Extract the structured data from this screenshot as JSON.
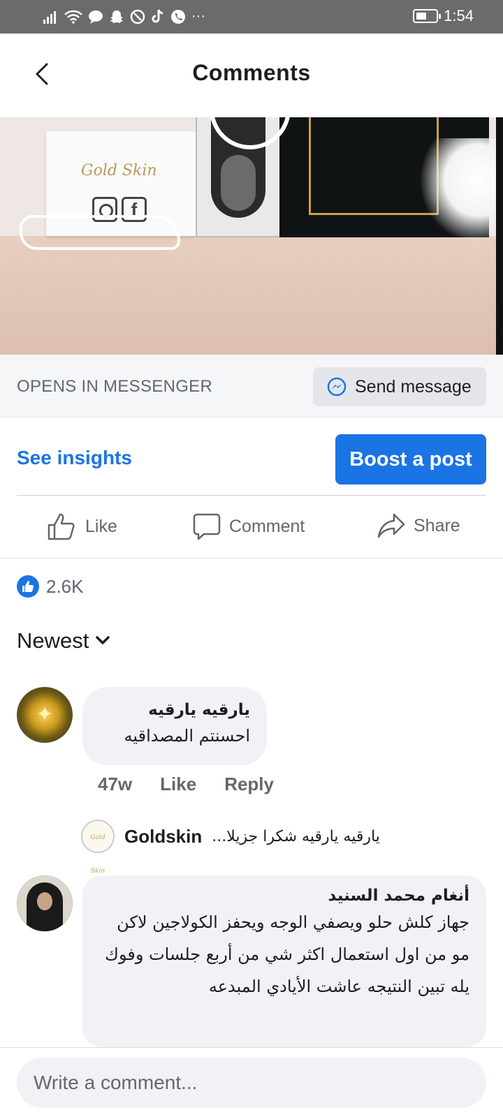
{
  "status_bar": {
    "time": "1:54",
    "more": "···"
  },
  "header": {
    "title": "Comments"
  },
  "post_media": {
    "brand_on_card": "Gold Skin"
  },
  "messenger_bar": {
    "opens_label": "OPENS IN MESSENGER",
    "send_button": "Send message"
  },
  "promo": {
    "see_insights": "See insights",
    "boost_button": "Boost a post"
  },
  "actions": {
    "like": "Like",
    "comment": "Comment",
    "share": "Share"
  },
  "reactions": {
    "count": "2.6K"
  },
  "sort": {
    "label": "Newest"
  },
  "comments": [
    {
      "author": "يارقيه يارقيه",
      "text": "احسنتم المصداقيه",
      "time": "47w",
      "like_label": "Like",
      "reply_label": "Reply",
      "reply": {
        "author": "Goldskin",
        "snippet": "يارقيه يارقيه شكرا جزيلا..."
      }
    },
    {
      "author": "أنغام محمد السنيد",
      "text": "جهاز كلش حلو ويصفي الوجه ويحفز الكولاجين لاكن مو من اول استعمال اكثر شي من أربع جلسات وفوك يله تبين النتيجه عاشت الأيادي المبدعه"
    }
  ],
  "composer": {
    "placeholder": "Write a comment..."
  },
  "colors": {
    "accent": "#1b74e4",
    "bubble": "#f0f2f5",
    "status_bar": "#6b6b6b"
  }
}
